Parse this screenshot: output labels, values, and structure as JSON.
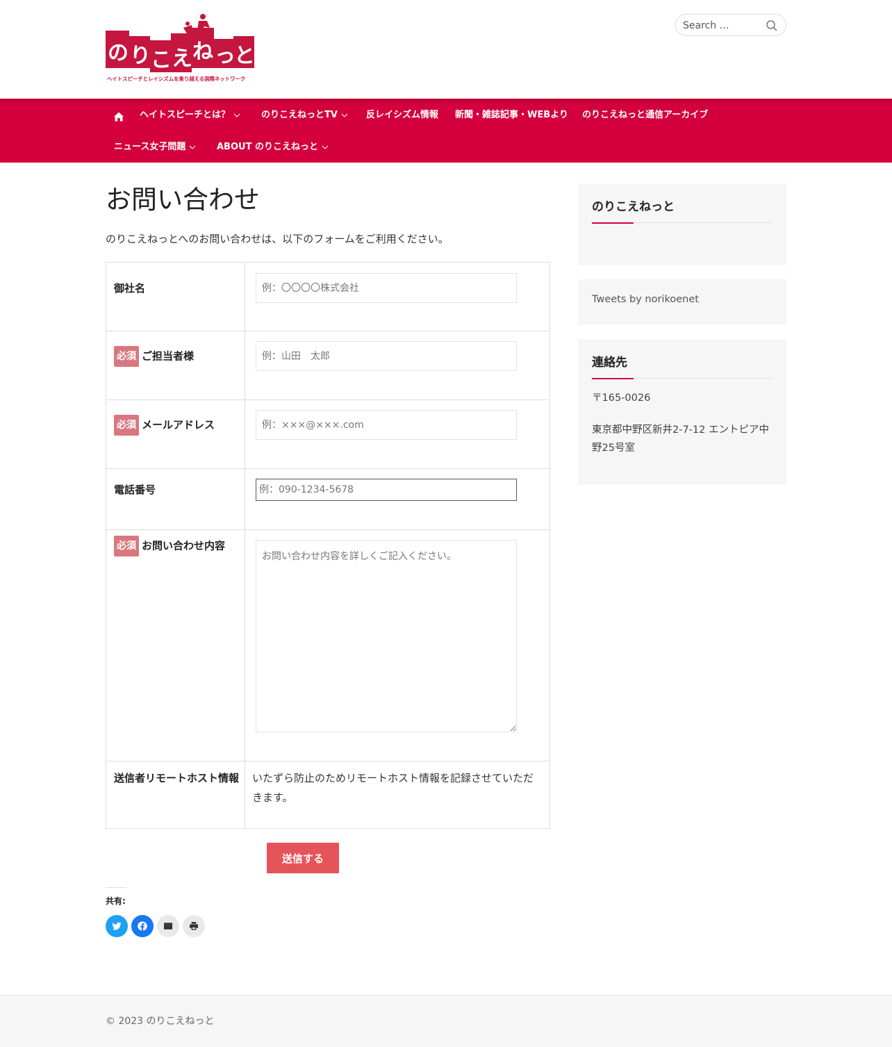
{
  "header": {
    "logo_text": "のりこえねっと",
    "logo_tagline": "ヘイトスピーチとレイシズムを乗り越える国際ネットワーク",
    "search": {
      "placeholder": "Search …"
    }
  },
  "nav": {
    "items": [
      {
        "label": "ヘイトスピーチとは？",
        "has_dropdown": true
      },
      {
        "label": "のりこえねっとTV",
        "has_dropdown": true
      },
      {
        "label": "反レイシズム情報",
        "has_dropdown": false
      },
      {
        "label": "新聞・雑誌記事・WEBより",
        "has_dropdown": false
      },
      {
        "label": "のりこえねっと通信アーカイブ",
        "has_dropdown": false
      },
      {
        "label": "ニュース女子問題",
        "has_dropdown": true
      },
      {
        "label": "ABOUT のりこえねっと",
        "has_dropdown": true
      }
    ]
  },
  "main": {
    "title": "お問い合わせ",
    "intro": "のりこえねっとへのお問い合わせは、以下のフォームをご利用ください。",
    "required_badge": "必須",
    "fields": [
      {
        "label": "御社名",
        "required": false,
        "placeholder": "例：〇〇〇〇株式会社"
      },
      {
        "label": "ご担当者様",
        "required": true,
        "placeholder": "例：山田　太郎"
      },
      {
        "label": "メールアドレス",
        "required": true,
        "placeholder": "例：×××@×××.com"
      },
      {
        "label": "電話番号",
        "required": false,
        "placeholder": "例：090-1234-5678"
      },
      {
        "label": "お問い合わせ内容",
        "required": true,
        "placeholder": "お問い合わせ内容を詳しくご記入ください。"
      },
      {
        "label": "送信者リモートホスト情報",
        "required": false,
        "value": "いたずら防止のためリモートホスト情報を記録させていただきます。"
      }
    ],
    "submit_label": "送信する",
    "share_label": "共有:"
  },
  "sidebar": {
    "widget1_title": "のりこえねっと",
    "tweets_link": "Tweets by norikoenet",
    "contact_title": "連絡先",
    "postal": "〒165-0026",
    "address": "東京都中野区新井2-7-12 エントピア中野25号室"
  },
  "footer": {
    "copyright": "© 2023 のりこえねっと"
  },
  "colors": {
    "brand": "#d3003d",
    "submit": "#e5545a",
    "required_badge": "#d9777f",
    "twitter": "#1da1f2",
    "facebook": "#1877f2"
  }
}
